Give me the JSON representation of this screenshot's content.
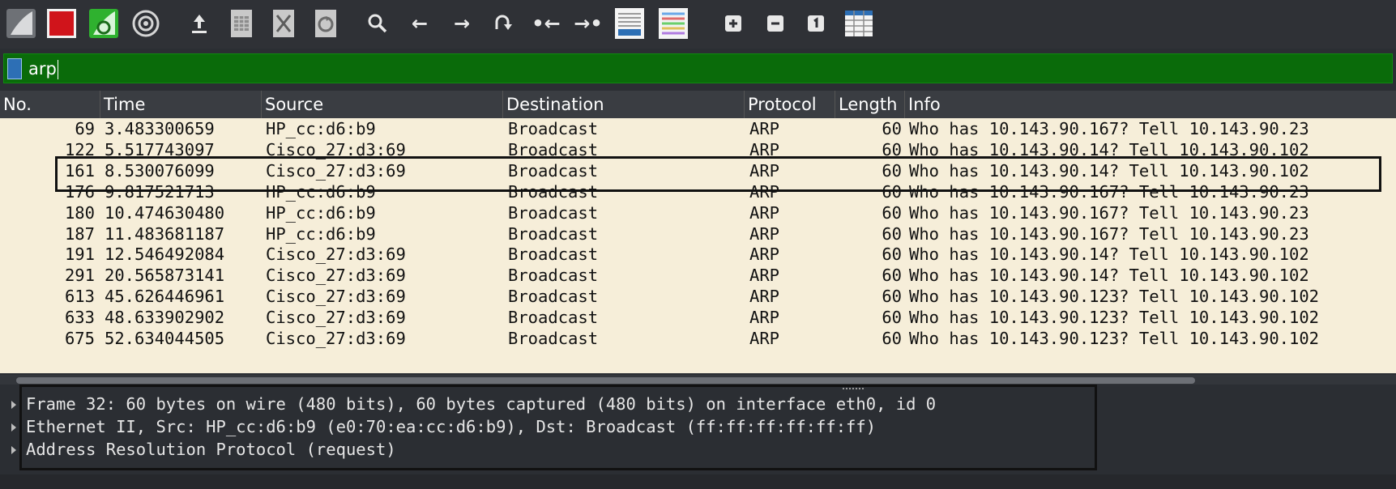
{
  "toolbar": {
    "buttons": [
      {
        "name": "start-capture-icon"
      },
      {
        "name": "stop-capture-icon"
      },
      {
        "name": "restart-capture-icon"
      },
      {
        "name": "capture-options-icon"
      },
      {
        "name": "open-file-icon"
      },
      {
        "name": "save-file-icon"
      },
      {
        "name": "close-file-icon"
      },
      {
        "name": "reload-file-icon"
      },
      {
        "name": "find-packet-icon"
      },
      {
        "name": "go-back-icon"
      },
      {
        "name": "go-forward-icon"
      },
      {
        "name": "go-to-packet-icon"
      },
      {
        "name": "go-first-packet-icon"
      },
      {
        "name": "go-last-packet-icon"
      },
      {
        "name": "auto-scroll-icon"
      },
      {
        "name": "colorize-icon"
      },
      {
        "name": "zoom-in-icon"
      },
      {
        "name": "zoom-out-icon"
      },
      {
        "name": "normal-size-icon"
      },
      {
        "name": "resize-columns-icon"
      }
    ]
  },
  "filter": {
    "value": "arp"
  },
  "columns": {
    "no": "No.",
    "time": "Time",
    "source": "Source",
    "destination": "Destination",
    "protocol": "Protocol",
    "length": "Length",
    "info": "Info"
  },
  "packets": [
    {
      "no": "69",
      "time": "3.483300659",
      "source": "HP_cc:d6:b9",
      "destination": "Broadcast",
      "protocol": "ARP",
      "length": "60",
      "info": "Who has 10.143.90.167? Tell 10.143.90.23"
    },
    {
      "no": "122",
      "time": "5.517743097",
      "source": "Cisco_27:d3:69",
      "destination": "Broadcast",
      "protocol": "ARP",
      "length": "60",
      "info": "Who has 10.143.90.14? Tell 10.143.90.102"
    },
    {
      "no": "161",
      "time": "8.530076099",
      "source": "Cisco_27:d3:69",
      "destination": "Broadcast",
      "protocol": "ARP",
      "length": "60",
      "info": "Who has 10.143.90.14? Tell 10.143.90.102"
    },
    {
      "no": "176",
      "time": "9.817521713",
      "source": "HP_cc:d6:b9",
      "destination": "Broadcast",
      "protocol": "ARP",
      "length": "60",
      "info": "Who has 10.143.90.167? Tell 10.143.90.23"
    },
    {
      "no": "180",
      "time": "10.474630480",
      "source": "HP_cc:d6:b9",
      "destination": "Broadcast",
      "protocol": "ARP",
      "length": "60",
      "info": "Who has 10.143.90.167? Tell 10.143.90.23"
    },
    {
      "no": "187",
      "time": "11.483681187",
      "source": "HP_cc:d6:b9",
      "destination": "Broadcast",
      "protocol": "ARP",
      "length": "60",
      "info": "Who has 10.143.90.167? Tell 10.143.90.23"
    },
    {
      "no": "191",
      "time": "12.546492084",
      "source": "Cisco_27:d3:69",
      "destination": "Broadcast",
      "protocol": "ARP",
      "length": "60",
      "info": "Who has 10.143.90.14? Tell 10.143.90.102"
    },
    {
      "no": "291",
      "time": "20.565873141",
      "source": "Cisco_27:d3:69",
      "destination": "Broadcast",
      "protocol": "ARP",
      "length": "60",
      "info": "Who has 10.143.90.14? Tell 10.143.90.102"
    },
    {
      "no": "613",
      "time": "45.626446961",
      "source": "Cisco_27:d3:69",
      "destination": "Broadcast",
      "protocol": "ARP",
      "length": "60",
      "info": "Who has 10.143.90.123? Tell 10.143.90.102"
    },
    {
      "no": "633",
      "time": "48.633902902",
      "source": "Cisco_27:d3:69",
      "destination": "Broadcast",
      "protocol": "ARP",
      "length": "60",
      "info": "Who has 10.143.90.123? Tell 10.143.90.102"
    },
    {
      "no": "675",
      "time": "52.634044505",
      "source": "Cisco_27:d3:69",
      "destination": "Broadcast",
      "protocol": "ARP",
      "length": "60",
      "info": "Who has 10.143.90.123? Tell 10.143.90.102"
    }
  ],
  "details": [
    "Frame 32: 60 bytes on wire (480 bits), 60 bytes captured (480 bits) on interface eth0, id 0",
    "Ethernet II, Src: HP_cc:d6:b9 (e0:70:ea:cc:d6:b9), Dst: Broadcast (ff:ff:ff:ff:ff:ff)",
    "Address Resolution Protocol (request)"
  ],
  "colors": {
    "filter_valid": "#0a6b0a",
    "row_background": "#f6eed9",
    "stop_red": "#d0141b",
    "restart_green": "#2fb12f"
  }
}
